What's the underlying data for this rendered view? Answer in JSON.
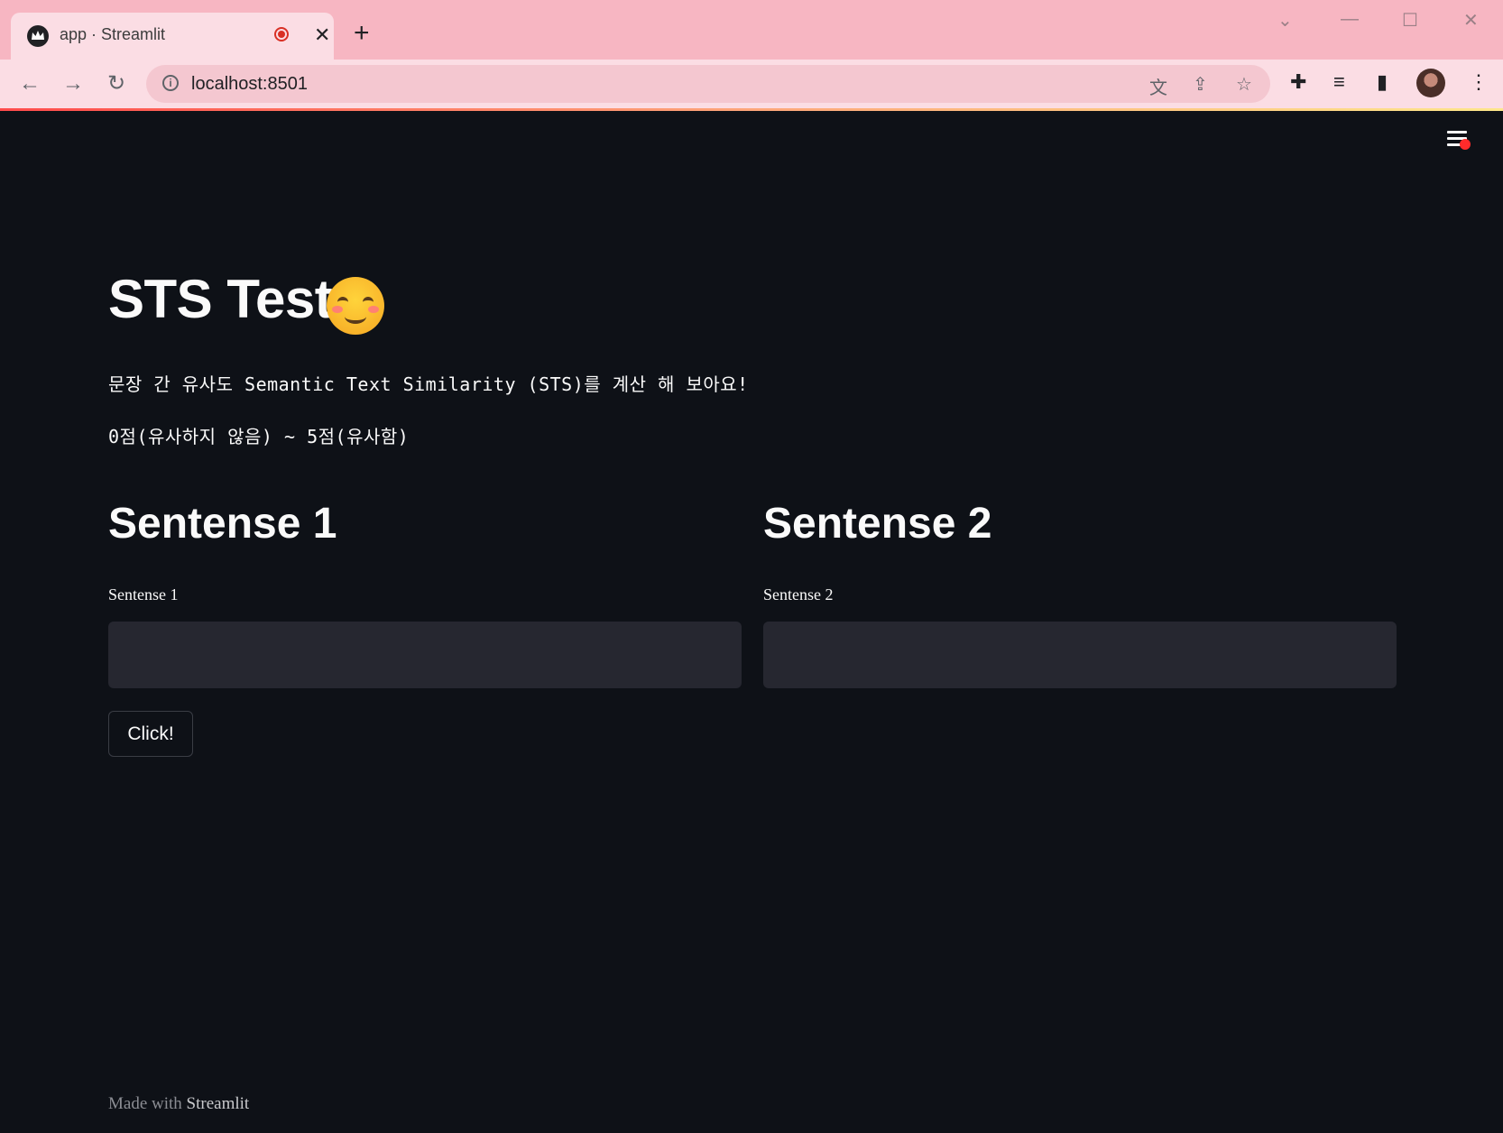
{
  "browser": {
    "tab_title": "app · Streamlit",
    "tab_close": "✕",
    "new_tab": "+",
    "url": "localhost:8501",
    "icons": [
      "streamlit-crown-icon",
      "record-icon",
      "close-icon",
      "plus-icon",
      "back-arrow-icon",
      "forward-arrow-icon",
      "reload-icon",
      "info-icon",
      "translate-icon",
      "share-icon",
      "star-icon",
      "extensions-icon",
      "media-control-icon",
      "side-panel-icon",
      "profile-avatar",
      "kebab-menu-icon",
      "minimize-icon",
      "maximize-icon",
      "window-close-icon",
      "tab-search-icon"
    ]
  },
  "app": {
    "title": "STS Test",
    "emoji": "smiling-face-emoji",
    "description": "문장 간 유사도 Semantic Text Similarity (STS)를 계산 해 보아요!",
    "score_range": "0점(유사하지 않음) ~ 5점(유사함)",
    "columns": [
      {
        "header": "Sentense 1",
        "label": "Sentense 1",
        "value": ""
      },
      {
        "header": "Sentense 2",
        "label": "Sentense 2",
        "value": ""
      }
    ],
    "button_label": "Click!",
    "footer_prefix": "Made with",
    "footer_brand": "Streamlit"
  },
  "colors": {
    "background": "#0e1117",
    "input_background": "#262730",
    "text": "#fafafa",
    "accent": "#ff4b4b",
    "chrome_titlebar": "#f7b6c2"
  }
}
